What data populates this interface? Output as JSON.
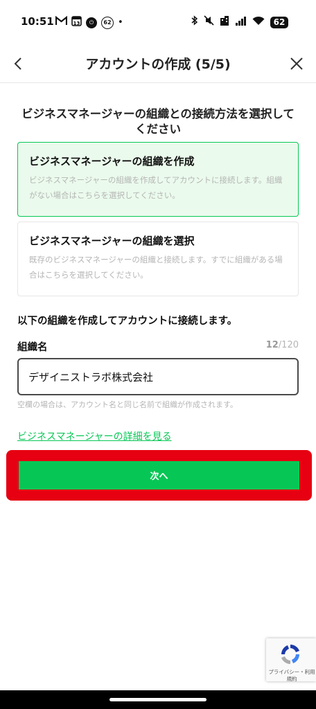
{
  "status_bar": {
    "time": "10:51",
    "left_icons": [
      "gmail-icon",
      "calendar-icon",
      "timer-icon",
      "badge-icon",
      "dot-icon"
    ],
    "calendar_day": "13",
    "badge_value": "62",
    "battery_level": "62"
  },
  "header": {
    "title": "アカウントの作成 (5/5)"
  },
  "question": "ビジネスマネージャーの組織との接続方法を選択してください",
  "options": [
    {
      "title": "ビジネスマネージャーの組織を作成",
      "description": "ビジネスマネージャーの組織を作成してアカウントに接続します。組織がない場合はこちらを選択してください。",
      "selected": true
    },
    {
      "title": "ビジネスマネージャーの組織を選択",
      "description": "既存のビジネスマネージャーの組織と接続します。すでに組織がある場合はこちらを選択してください。",
      "selected": false
    }
  ],
  "form": {
    "connect_text": "以下の組織を作成してアカウントに接続します。",
    "org_label": "組織名",
    "count_current": "12",
    "count_max": "/120",
    "org_value": "デザイニストラボ株式会社",
    "helper": "空欄の場合は、アカウント名と同じ名前で組織が作成されます。"
  },
  "link_text": "ビジネスマネージャーの詳細を見る",
  "next_button": "次へ",
  "recaptcha": {
    "text": "プライバシー・利用規約"
  },
  "colors": {
    "accent": "#06c755",
    "highlight": "#e60012"
  }
}
